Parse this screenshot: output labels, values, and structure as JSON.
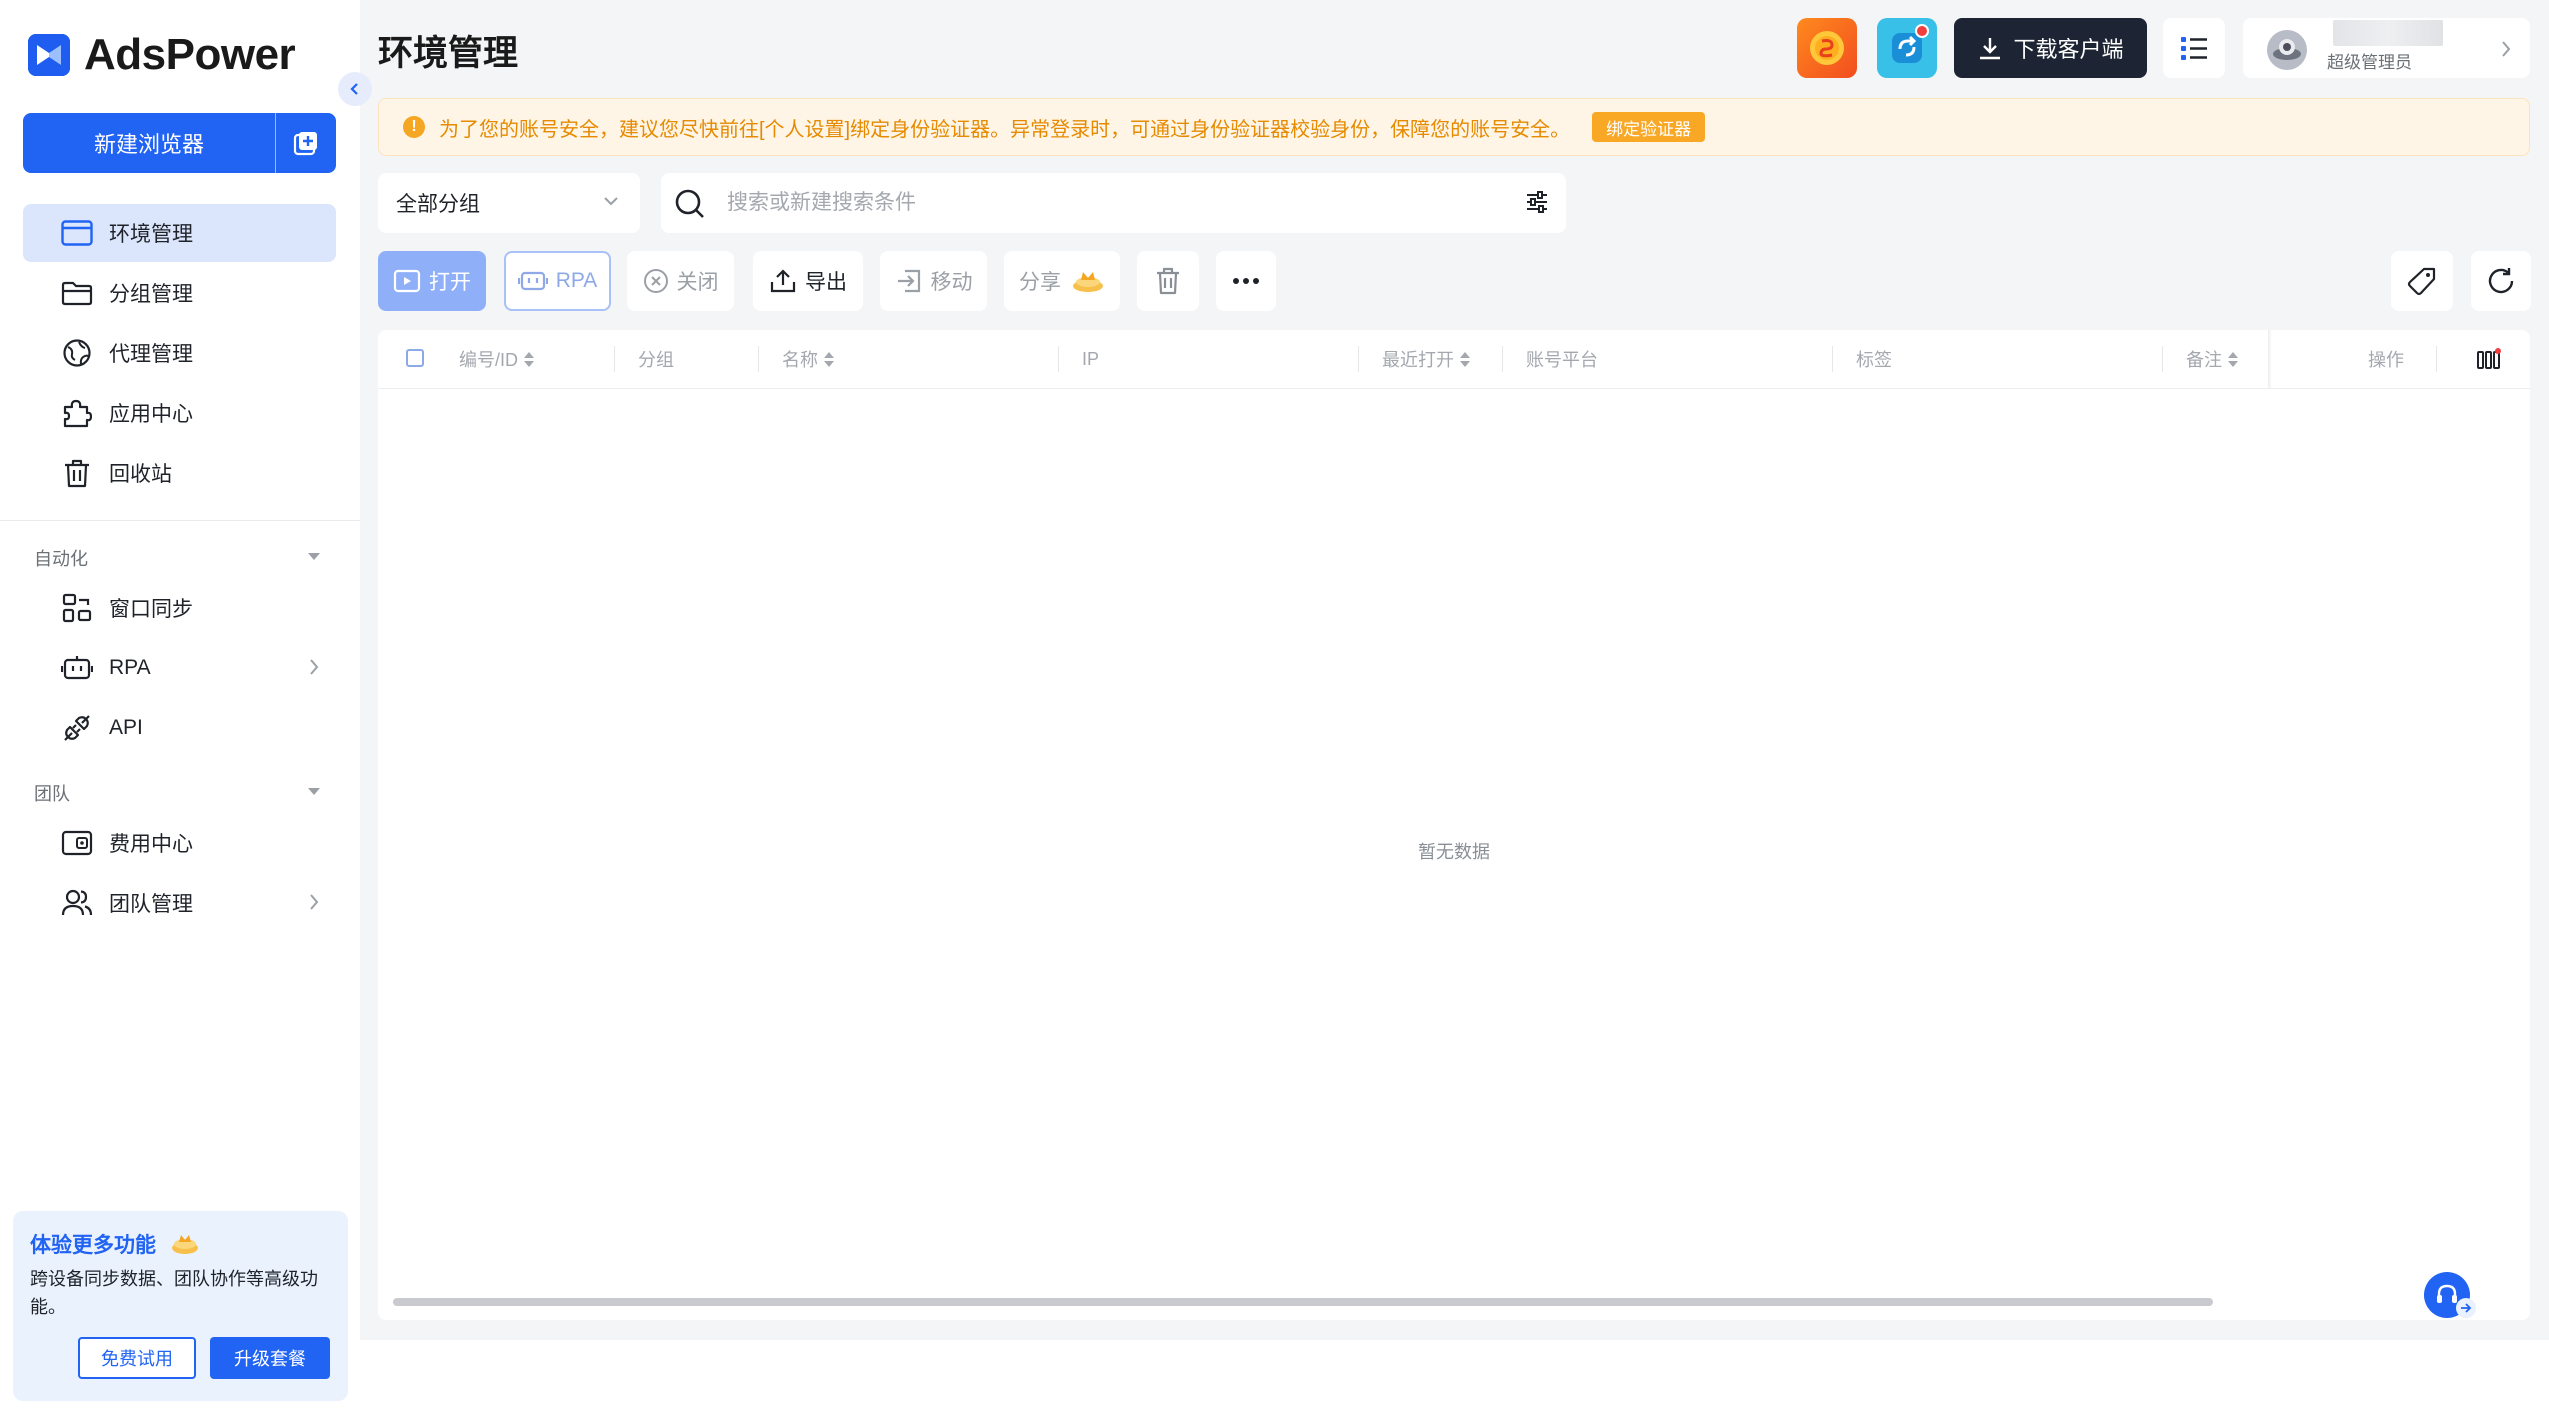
{
  "app": {
    "brand": "AdsPower",
    "page_title": "环境管理"
  },
  "sidebar": {
    "new_browser_label": "新建浏览器",
    "items": [
      {
        "label": "环境管理",
        "icon": "browser-window-icon",
        "active": true
      },
      {
        "label": "分组管理",
        "icon": "folder-icon"
      },
      {
        "label": "代理管理",
        "icon": "proxy-globe-icon"
      },
      {
        "label": "应用中心",
        "icon": "puzzle-icon"
      },
      {
        "label": "回收站",
        "icon": "trash-icon"
      }
    ],
    "section_automation": "自动化",
    "automation_items": [
      {
        "label": "窗口同步",
        "icon": "window-sync-icon"
      },
      {
        "label": "RPA",
        "icon": "robot-icon",
        "has_submenu": true
      },
      {
        "label": "API",
        "icon": "plug-icon"
      }
    ],
    "section_team": "团队",
    "team_items": [
      {
        "label": "费用中心",
        "icon": "wallet-icon"
      },
      {
        "label": "团队管理",
        "icon": "users-icon",
        "has_submenu": true
      }
    ],
    "promo": {
      "title": "体验更多功能",
      "description": "跨设备同步数据、团队协作等高级功能。",
      "trial_label": "免费试用",
      "upgrade_label": "升级套餐"
    }
  },
  "header": {
    "download_label": "下载客户端",
    "user_role": "超级管理员"
  },
  "alert": {
    "text": "为了您的账号安全，建议您尽快前往[个人设置]绑定身份验证器。异常登录时，可通过身份验证器校验身份，保障您的账号安全。",
    "button_label": "绑定验证器"
  },
  "filters": {
    "group_selected": "全部分组",
    "search_placeholder": "搜索或新建搜索条件"
  },
  "toolbar": {
    "open": "打开",
    "rpa": "RPA",
    "close": "关闭",
    "export": "导出",
    "move": "移动",
    "share": "分享"
  },
  "table": {
    "columns": {
      "id": "编号/ID",
      "group": "分组",
      "name": "名称",
      "ip": "IP",
      "last_open": "最近打开",
      "platform": "账号平台",
      "tags": "标签",
      "notes": "备注",
      "actions": "操作"
    },
    "empty_text": "暂无数据"
  },
  "colors": {
    "primary": "#2163f3",
    "dark_button": "#1d2433",
    "warning_text": "#e68a00",
    "warning_bg": "#fff5e6"
  }
}
